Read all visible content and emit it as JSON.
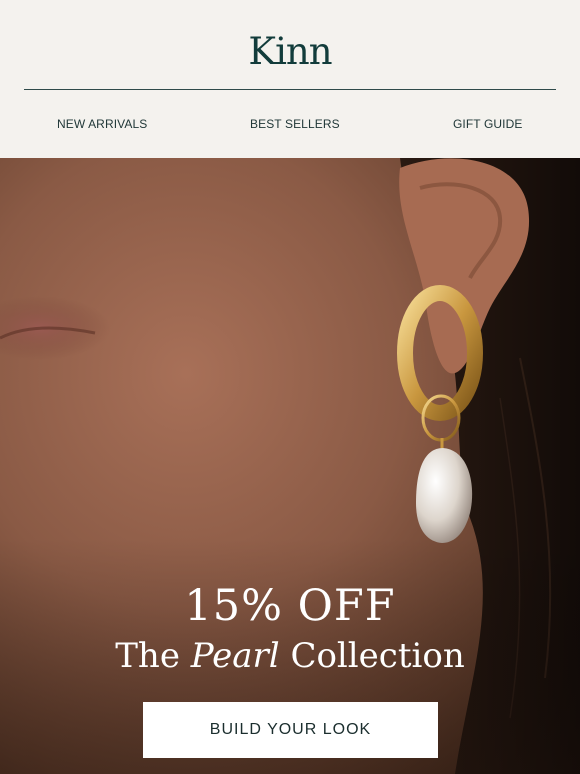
{
  "brand": {
    "logo_text": "Kinn"
  },
  "nav": {
    "items": [
      {
        "label": "NEW ARRIVALS"
      },
      {
        "label": "BEST SELLERS"
      },
      {
        "label": "GIFT GUIDE"
      }
    ]
  },
  "hero": {
    "offer": "15% OFF",
    "collection_prefix": "The ",
    "collection_italic": "Pearl",
    "collection_suffix": " Collection",
    "cta_label": "BUILD YOUR LOOK",
    "image_subject": "close-up of ear wearing gold hoop with pearl drop earring"
  },
  "colors": {
    "header_bg": "#f4f2ee",
    "brand_text": "#123c3b",
    "nav_text": "#213838",
    "cta_bg": "#ffffff",
    "cta_text": "#1b2e2e",
    "headline_text": "#ffffff"
  }
}
